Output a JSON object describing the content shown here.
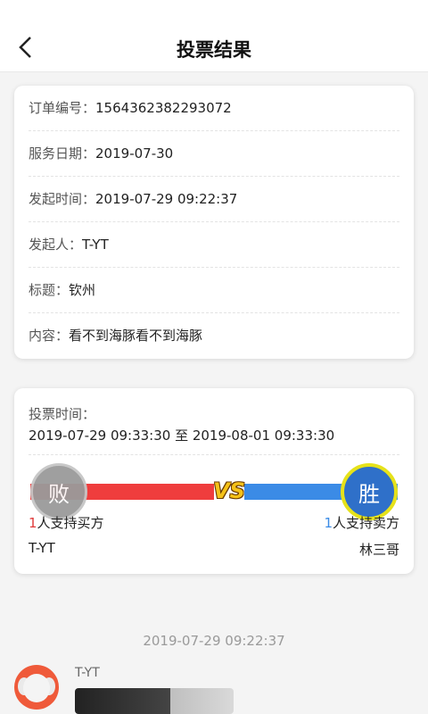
{
  "header": {
    "title": "投票结果",
    "back_icon": "chevron-left-icon"
  },
  "order_info": {
    "order_no_label": "订单编号：",
    "order_no": "1564362382293072",
    "service_date_label": "服务日期：",
    "service_date": "2019-07-30",
    "start_time_label": "发起时间：",
    "start_time": "2019-07-29 09:22:37",
    "initiator_label": "发起人：",
    "initiator": "T-YT",
    "subject_label": "标题：",
    "subject": "钦州",
    "content_label": "内容：",
    "content": "看不到海豚看不到海豚"
  },
  "vote": {
    "time_label": "投票时间：",
    "time_range": "2019-07-29 09:33:30 至 2019-08-01 09:33:30",
    "vs_text": "VS",
    "left_badge": "败",
    "right_badge": "胜",
    "left_count": "1",
    "left_support_text": "人支持买方",
    "right_count": "1",
    "right_support_text": "人支持卖方",
    "left_name": "T-YT",
    "right_name": "林三哥",
    "colors": {
      "buyer": "#ef3d3d",
      "seller": "#3b8be6",
      "vs": "#f5c218"
    }
  },
  "chat": {
    "timestamp": "2019-07-29 09:22:37",
    "sender": "T-YT",
    "avatar_icon": "elephant-avatar-icon"
  }
}
